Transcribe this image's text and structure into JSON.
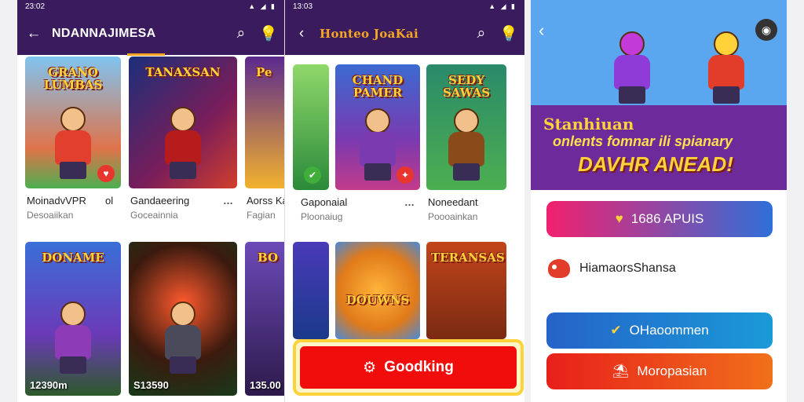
{
  "screen1": {
    "status_time": "23:02",
    "status_icons": "▲ ◢ ▮",
    "appbar": {
      "back_icon": "←",
      "title": "NDANNAJIMESA",
      "search_icon": "⌕",
      "bulb_icon": "💡"
    },
    "cards": [
      {
        "art_title": "GRANO LUMBAS",
        "name": "MoinadvVPR",
        "desc": "Desoaiikan",
        "extra": "ol"
      },
      {
        "art_title": "TANAXSAN",
        "name": "Gandaeering",
        "desc": "Goceainnia"
      },
      {
        "art_title": "Pe",
        "name": "Aorss Ka",
        "desc": "Fagian"
      },
      {
        "art_title": "DONAME",
        "price": "12390m"
      },
      {
        "art_title": "",
        "price": "S13590"
      },
      {
        "art_title": "BO",
        "price": "135.00"
      }
    ],
    "more_icon": "…"
  },
  "screen2": {
    "status_time": "13:03",
    "status_icons": "▲ ◢ ▮",
    "appbar": {
      "back_icon": "‹",
      "title": "Honteo JoaKai",
      "search_icon": "⌕",
      "bulb_icon": "💡"
    },
    "cards": [
      {
        "art_title": ""
      },
      {
        "art_title": "CHAND PAMER"
      },
      {
        "art_title": "SEDY SAWAS"
      },
      {
        "art_title": ""
      },
      {
        "art_title": "DOUWNS"
      },
      {
        "art_title": "TERANSAS"
      }
    ],
    "meta": [
      {
        "name": "Gaponaial",
        "desc": "Ploonaiug"
      },
      {
        "name": "Noneedant",
        "desc": "Poooainkan"
      }
    ],
    "more_icon": "…",
    "cta": {
      "icon": "⚙",
      "label": "Goodking"
    }
  },
  "screen3": {
    "banner": {
      "line1": "Stanhiuan",
      "line2": "onlents fomnar ili spianary",
      "line3": "DAVHR ANEAD!"
    },
    "back_icon": "‹",
    "camera_icon": "◉",
    "buttons": [
      {
        "icon": "♥",
        "label": "1686 APUIS"
      },
      {
        "icon": "✔",
        "label": "OHaoommen"
      },
      {
        "icon": "⛱",
        "label": "Moropasian"
      }
    ],
    "row_label": "HiamaorsShansa"
  },
  "colors": {
    "appbar": "#3a1b5e",
    "accent": "#f6a623",
    "cta_red": "#f20d0d",
    "cta_border": "#ffd23a"
  }
}
